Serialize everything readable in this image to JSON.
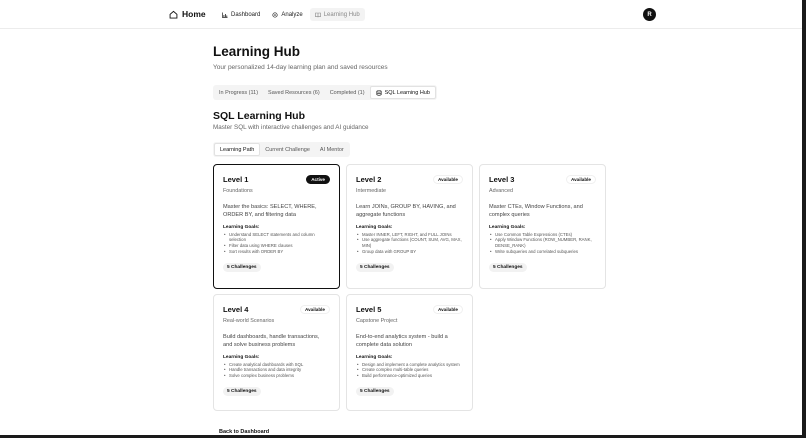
{
  "nav": {
    "home": "Home",
    "links": [
      {
        "label": "Dashboard",
        "icon": "bar-chart-icon"
      },
      {
        "label": "Analyze",
        "icon": "gear-icon"
      },
      {
        "label": "Learning Hub",
        "icon": "book-open-icon"
      }
    ],
    "avatar": "R"
  },
  "header": {
    "title": "Learning Hub",
    "subtitle": "Your personalized 14-day learning plan and saved resources"
  },
  "main_tabs": [
    {
      "label": "In Progress (11)"
    },
    {
      "label": "Saved Resources (6)"
    },
    {
      "label": "Completed (1)"
    },
    {
      "label": "SQL Learning Hub",
      "icon": "database-icon"
    }
  ],
  "section": {
    "title": "SQL Learning Hub",
    "subtitle": "Master SQL with interactive challenges and AI guidance"
  },
  "sub_tabs": [
    {
      "label": "Learning Path"
    },
    {
      "label": "Current Challenge"
    },
    {
      "label": "AI Mentor"
    }
  ],
  "goals_label": "Learning Goals:",
  "levels": [
    {
      "title": "Level 1",
      "badge": "Active",
      "subtitle": "Foundations",
      "desc": "Master the basics: SELECT, WHERE, ORDER BY, and filtering data",
      "goals": [
        "Understand SELECT statements and column selection",
        "Filter data using WHERE clauses",
        "Sort results with ORDER BY"
      ],
      "challenges": "5 Challenges"
    },
    {
      "title": "Level 2",
      "badge": "Available",
      "subtitle": "Intermediate",
      "desc": "Learn JOINs, GROUP BY, HAVING, and aggregate functions",
      "goals": [
        "Master INNER, LEFT, RIGHT, and FULL JOINs",
        "Use aggregate functions (COUNT, SUM, AVG, MAX, MIN)",
        "Group data with GROUP BY"
      ],
      "challenges": "5 Challenges"
    },
    {
      "title": "Level 3",
      "badge": "Available",
      "subtitle": "Advanced",
      "desc": "Master CTEs, Window Functions, and complex queries",
      "goals": [
        "Use Common Table Expressions (CTEs)",
        "Apply Window Functions (ROW_NUMBER, RANK, DENSE_RANK)",
        "Write subqueries and correlated subqueries"
      ],
      "challenges": "5 Challenges"
    },
    {
      "title": "Level 4",
      "badge": "Available",
      "subtitle": "Real-world Scenarios",
      "desc": "Build dashboards, handle transactions, and solve business problems",
      "goals": [
        "Create analytical dashboards with SQL",
        "Handle transactions and data integrity",
        "Solve complex business problems"
      ],
      "challenges": "5 Challenges"
    },
    {
      "title": "Level 5",
      "badge": "Available",
      "subtitle": "Capstone Project",
      "desc": "End-to-end analytics system - build a complete data solution",
      "goals": [
        "Design and implement a complete analytics system",
        "Create complex multi-table queries",
        "Build performance-optimized queries"
      ],
      "challenges": "5 Challenges"
    }
  ],
  "back": "Back to Dashboard"
}
